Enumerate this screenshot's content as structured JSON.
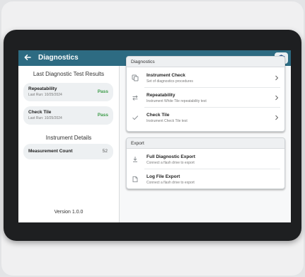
{
  "app": {
    "title": "Diagnostics",
    "accent_color": "#2d6b82",
    "pass_color": "#3c9b48",
    "back_icon": "back-arrow-icon",
    "logo_icon": "brand-logo-icon"
  },
  "left": {
    "results_heading": "Last Diagnostic Test Results",
    "results": [
      {
        "name": "Repeatability",
        "last_run": "Last Run: 10/25/2024",
        "status": "Pass"
      },
      {
        "name": "Check Tile",
        "last_run": "Last Run: 10/25/2024",
        "status": "Pass"
      }
    ],
    "details_heading": "Instrument Details",
    "details": [
      {
        "label": "Measurement Count",
        "value": "52"
      }
    ],
    "version": "Version 1.0.0"
  },
  "diagnostics": {
    "header": "Diagnostics",
    "items": [
      {
        "title": "Instrument Check",
        "subtitle": "Set of diagnostics procedures",
        "icon": "copy-icon"
      },
      {
        "title": "Repeatability",
        "subtitle": "Instrument White Tile repeatability test",
        "icon": "repeat-arrows-icon"
      },
      {
        "title": "Check Tile",
        "subtitle": "Instrument Check Tile test",
        "icon": "checkmark-icon"
      }
    ]
  },
  "export": {
    "header": "Export",
    "items": [
      {
        "title": "Full Diagnostic Export",
        "subtitle": "Connect a flash drive to export",
        "icon": "download-icon"
      },
      {
        "title": "Log File Export",
        "subtitle": "Connect a flash drive to export",
        "icon": "file-icon"
      }
    ]
  }
}
